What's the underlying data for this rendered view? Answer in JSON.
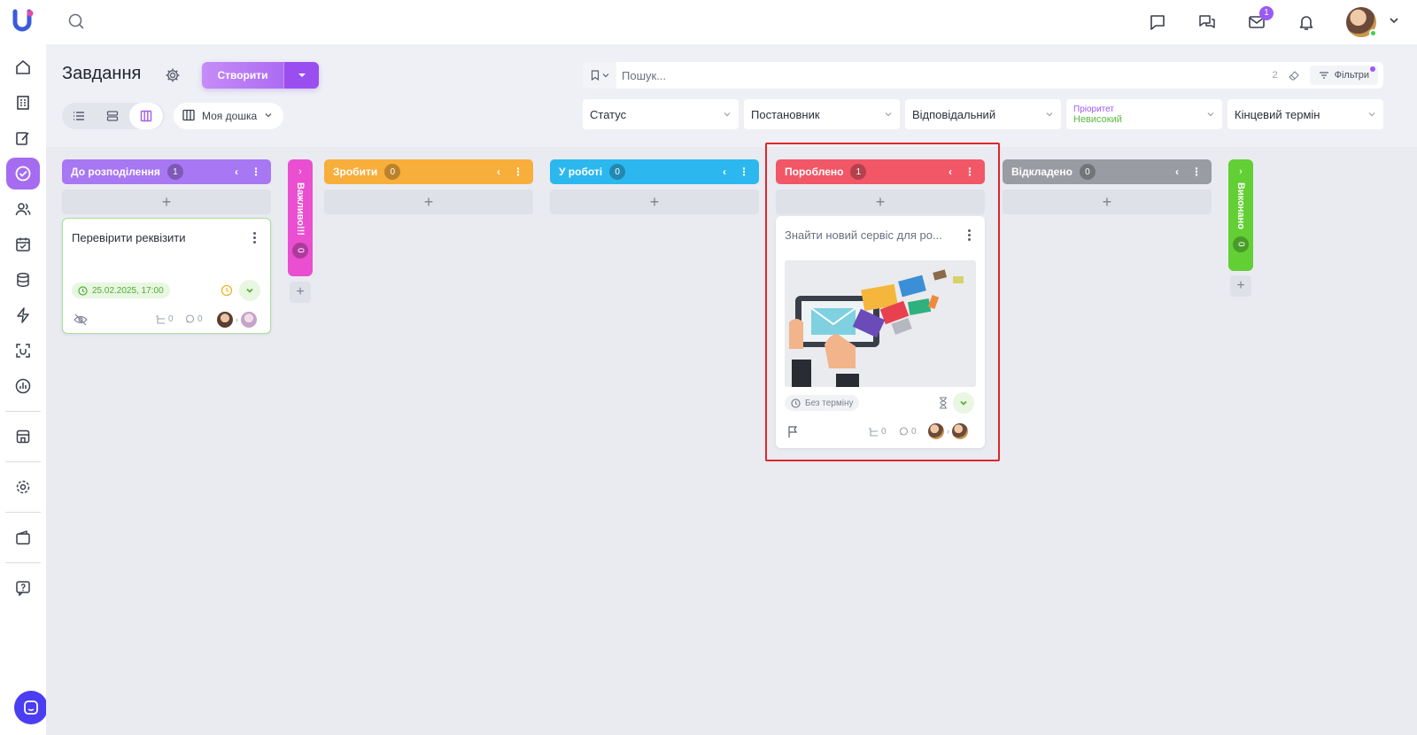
{
  "topbar": {
    "mail_badge": "1"
  },
  "header": {
    "title": "Завдання",
    "create_label": "Створити",
    "board_name": "Моя дошка"
  },
  "search": {
    "placeholder": "Пошук...",
    "count": "2",
    "filters_label": "Фільтри"
  },
  "filters": {
    "status": "Статус",
    "author": "Постановник",
    "responsible": "Відповідальний",
    "priority_label": "Пріоритет",
    "priority_value": "Невисокий",
    "deadline": "Кінцевий термін"
  },
  "columns": [
    {
      "title": "До розподілення",
      "count": "1",
      "color": "#a877f3"
    },
    {
      "title": "Важливо!!!",
      "count": "0",
      "color": "#e94fd0"
    },
    {
      "title": "Зробити",
      "count": "0",
      "color": "#f8ae3b"
    },
    {
      "title": "У роботі",
      "count": "0",
      "color": "#2cb8ee"
    },
    {
      "title": "Пороблено",
      "count": "1",
      "color": "#f25767"
    },
    {
      "title": "Відкладено",
      "count": "0",
      "color": "#9a9ca3"
    },
    {
      "title": "Виконано",
      "count": "0",
      "color": "#62cf34"
    }
  ],
  "cards": {
    "card1": {
      "title": "Перевірити реквізити",
      "date": "25.02.2025, 17:00",
      "subtasks": "0",
      "comments": "0"
    },
    "card2": {
      "title": "Знайти новий сервіс для ро...",
      "deadline": "Без терміну",
      "subtasks": "0",
      "comments": "0"
    }
  },
  "colors": {
    "accent": "#a35df0",
    "highlight": "#e0262c"
  }
}
